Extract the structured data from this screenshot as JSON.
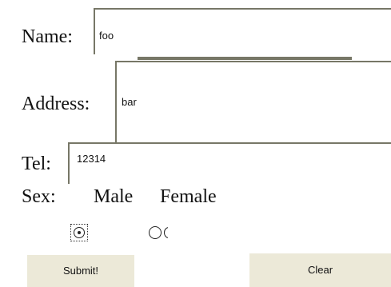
{
  "form": {
    "name_label": "Name:",
    "name_value": "foo",
    "address_label": "Address:",
    "address_value": "bar",
    "tel_label": "Tel:",
    "tel_value": "12314",
    "sex_label": "Sex:",
    "male_label": "Male",
    "female_label": "Female",
    "sex_selected": "Male",
    "submit_label": "Submit!",
    "clear_label": "Clear"
  },
  "colors": {
    "field_border": "#777767",
    "button_face": "#ece9d8"
  }
}
